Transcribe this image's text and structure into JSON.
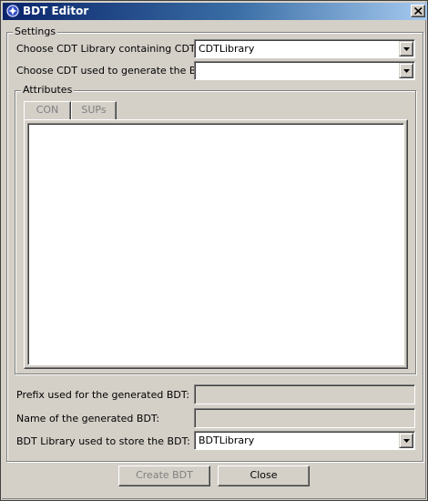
{
  "window": {
    "title": "BDT Editor"
  },
  "settings": {
    "group_label": "Settings",
    "cdt_library_label": "Choose CDT Library containing CDTs:",
    "cdt_library_value": "CDTLibrary",
    "cdt_label": "Choose CDT used to generate the BDT:",
    "cdt_value": ""
  },
  "attributes": {
    "group_label": "Attributes",
    "tabs": [
      {
        "label": "CON"
      },
      {
        "label": "SUPs"
      }
    ]
  },
  "fields": {
    "prefix_label": "Prefix used for the generated BDT:",
    "prefix_value": "",
    "name_label": "Name of the generated BDT:",
    "name_value": "",
    "bdt_library_label": "BDT Library used to store the BDT:",
    "bdt_library_value": "BDTLibrary"
  },
  "buttons": {
    "create_label": "Create BDT",
    "close_label": "Close"
  },
  "icons": {
    "app": "bdt-editor-icon",
    "close": "close-icon",
    "dropdown": "chevron-down-icon"
  },
  "colors": {
    "titlebar_start": "#0a246a",
    "titlebar_end": "#a6caf0",
    "face": "#d4d0c8",
    "disabled_text": "#808080"
  }
}
